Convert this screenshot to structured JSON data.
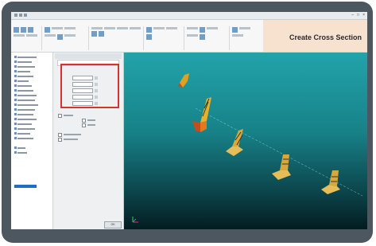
{
  "window": {
    "title": "Create Cross Section",
    "controls": [
      "–",
      "□",
      "×"
    ]
  },
  "ribbon": {
    "tabs": [
      "File",
      "Home",
      "Tools",
      "Model",
      "View",
      "Mesh",
      "Loads",
      "Results",
      "Help"
    ]
  },
  "banner": {
    "text": "Create Cross Section",
    "color": "#f7e2cf"
  },
  "dialog": {
    "ok_label": "OK"
  },
  "colors": {
    "highlight": "#d6342b",
    "viewport_top": "#22a3aa",
    "viewport_bottom": "#031c20",
    "section": "#e0a020"
  },
  "icons": {
    "axis_triad": "axis-triad-icon"
  }
}
